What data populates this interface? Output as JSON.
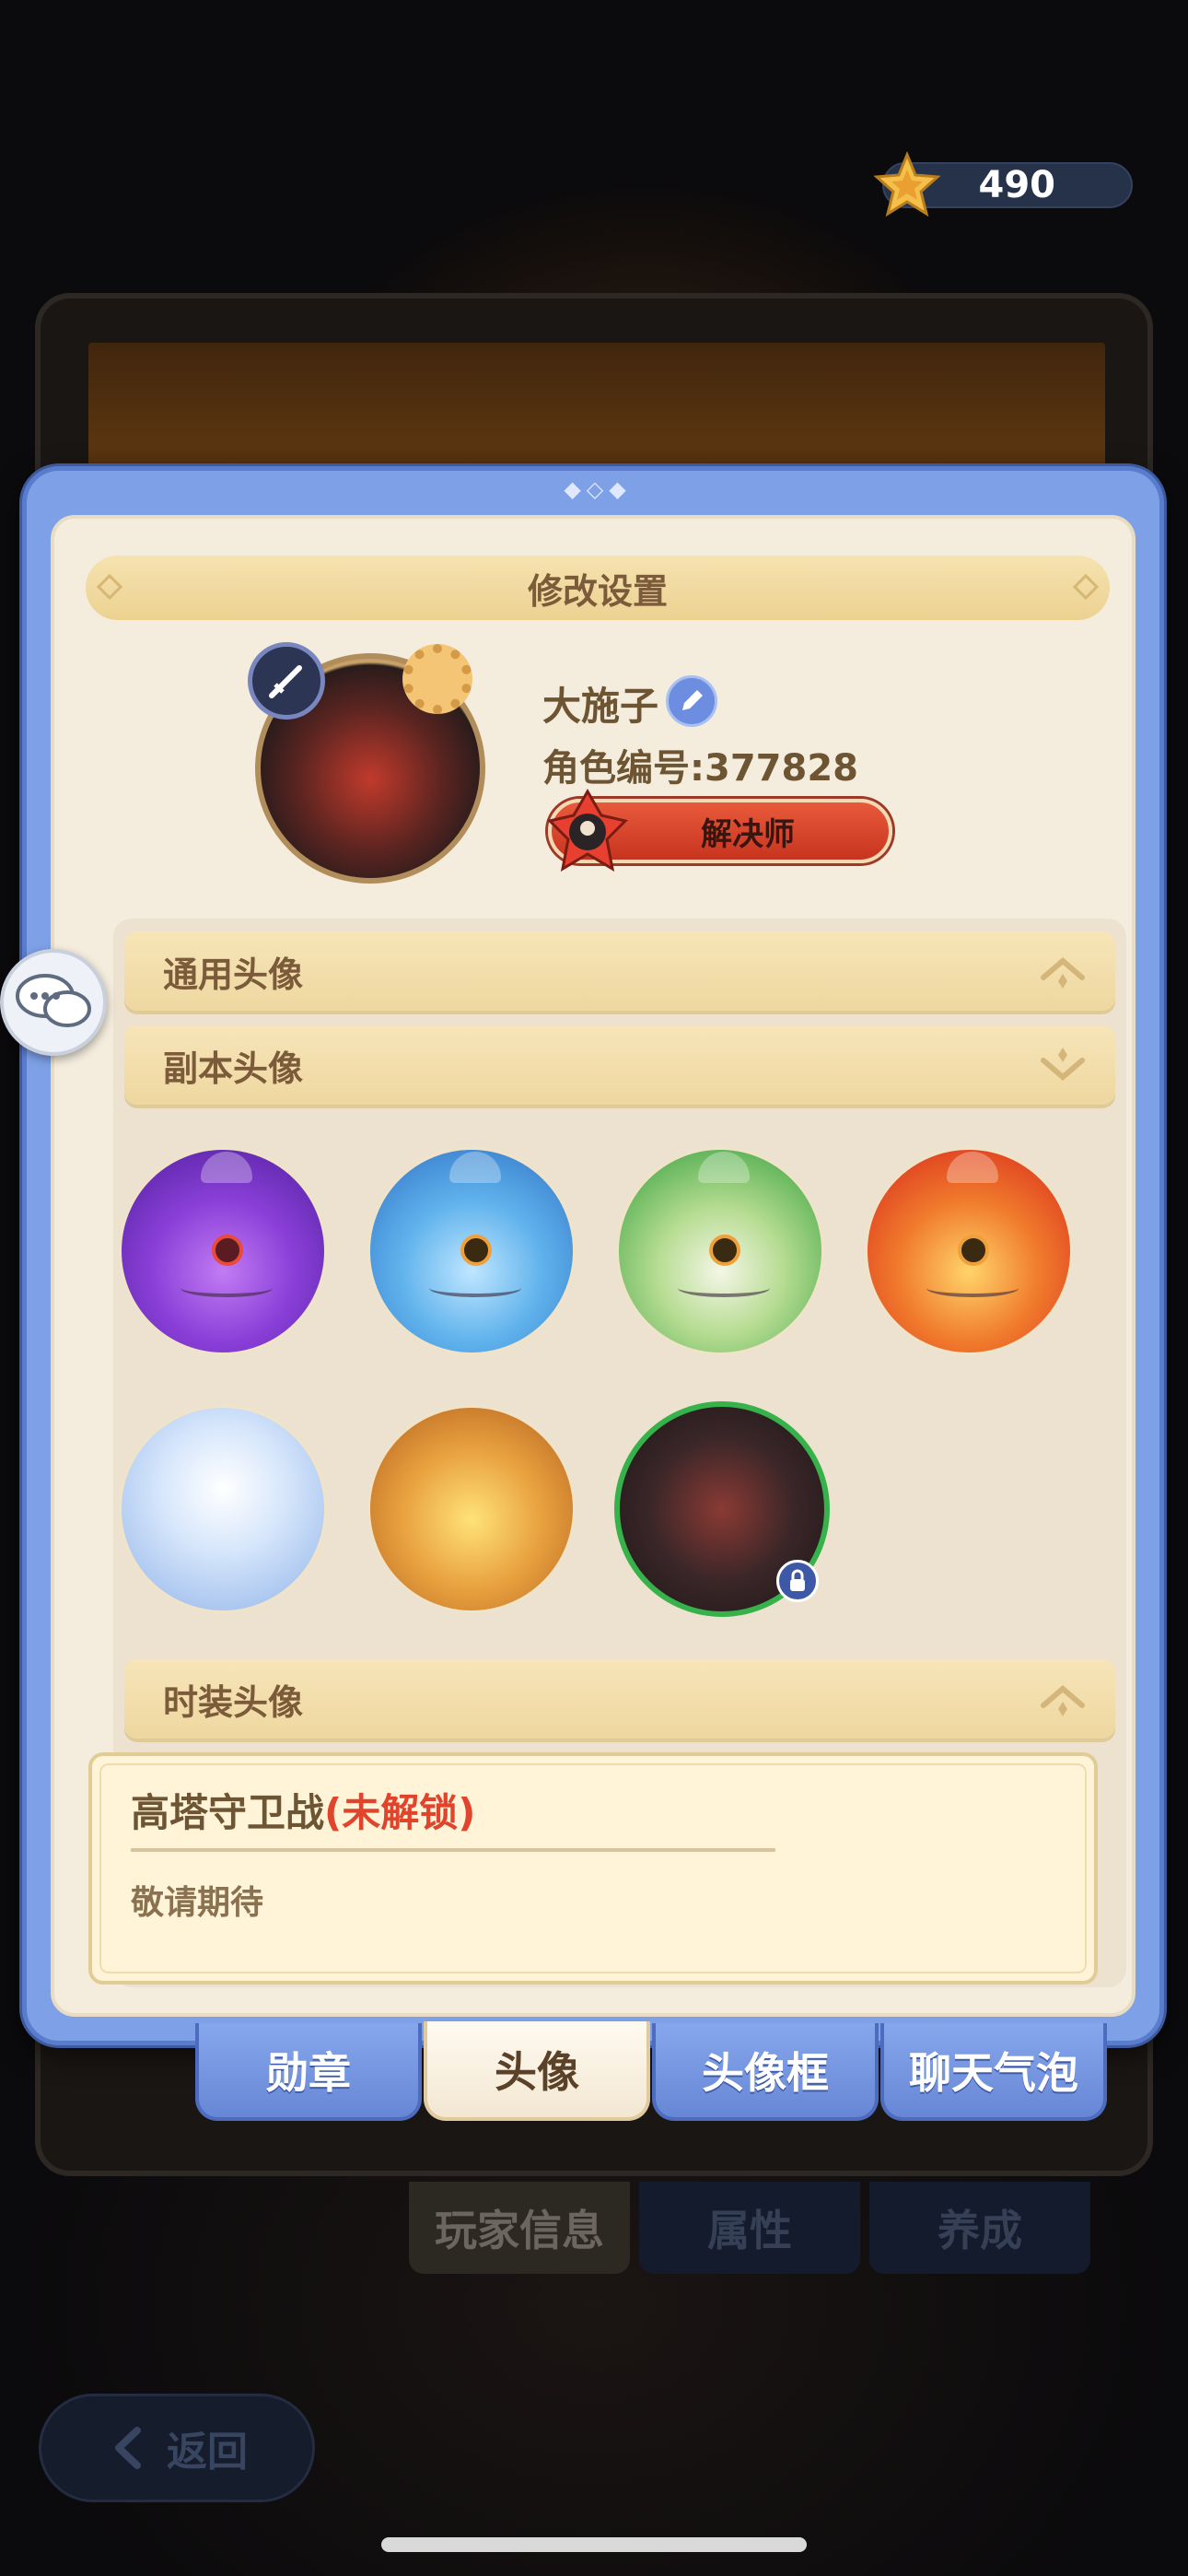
{
  "currency": {
    "amount": "490"
  },
  "modal": {
    "title": "修改设置",
    "player": {
      "name": "大施子",
      "id_label": "角色编号:377828",
      "title_badge": "解决师"
    },
    "sections": [
      {
        "label": "通用头像",
        "state": "collapsed"
      },
      {
        "label": "副本头像",
        "state": "expanded"
      },
      {
        "label": "时装头像",
        "state": "collapsed"
      }
    ],
    "info": {
      "name": "高塔守卫战",
      "status": "(未解锁)",
      "description": "敬请期待"
    },
    "tabs": [
      {
        "label": "勋章",
        "active": false
      },
      {
        "label": "头像",
        "active": true
      },
      {
        "label": "头像框",
        "active": false
      },
      {
        "label": "聊天气泡",
        "active": false
      }
    ]
  },
  "background": {
    "tabs": [
      "玩家信息",
      "属性",
      "养成"
    ],
    "back_label": "返回"
  },
  "colors": {
    "modal_blue": "#7ea0e6",
    "panel_cream": "#f4ecdd",
    "header_gold": "#eed7a0",
    "locked_red": "#e0442c",
    "lock_green": "#37b24a"
  }
}
